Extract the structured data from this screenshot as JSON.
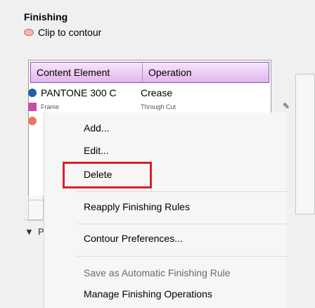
{
  "panel": {
    "title": "Finishing",
    "clip_label": "Clip to contour"
  },
  "table": {
    "columns": [
      "Content Element",
      "Operation"
    ],
    "rows": [
      {
        "name": "PANTONE 300 C",
        "operation": "Crease",
        "swatch_color": "#1f5fa6"
      },
      {
        "name": "Frame",
        "operation": "Through Cut",
        "swatch_color": "#c84fa4"
      },
      {
        "name": "",
        "operation": "",
        "swatch_color": "#e9795a"
      }
    ]
  },
  "collapse_label": "P",
  "context_menu": {
    "items": [
      {
        "label": "Add...",
        "enabled": true
      },
      {
        "label": "Edit...",
        "enabled": true
      },
      {
        "label": "Delete",
        "enabled": true,
        "highlighted": true
      },
      {
        "label": "Reapply Finishing Rules",
        "enabled": true
      },
      {
        "label": "Contour Preferences...",
        "enabled": true
      },
      {
        "label": "Save as Automatic Finishing Rule",
        "enabled": false
      },
      {
        "label": "Manage Finishing Operations",
        "enabled": true
      }
    ]
  },
  "colors": {
    "header_purple": "#e2b5ee",
    "highlight_red": "#dc1f26"
  }
}
